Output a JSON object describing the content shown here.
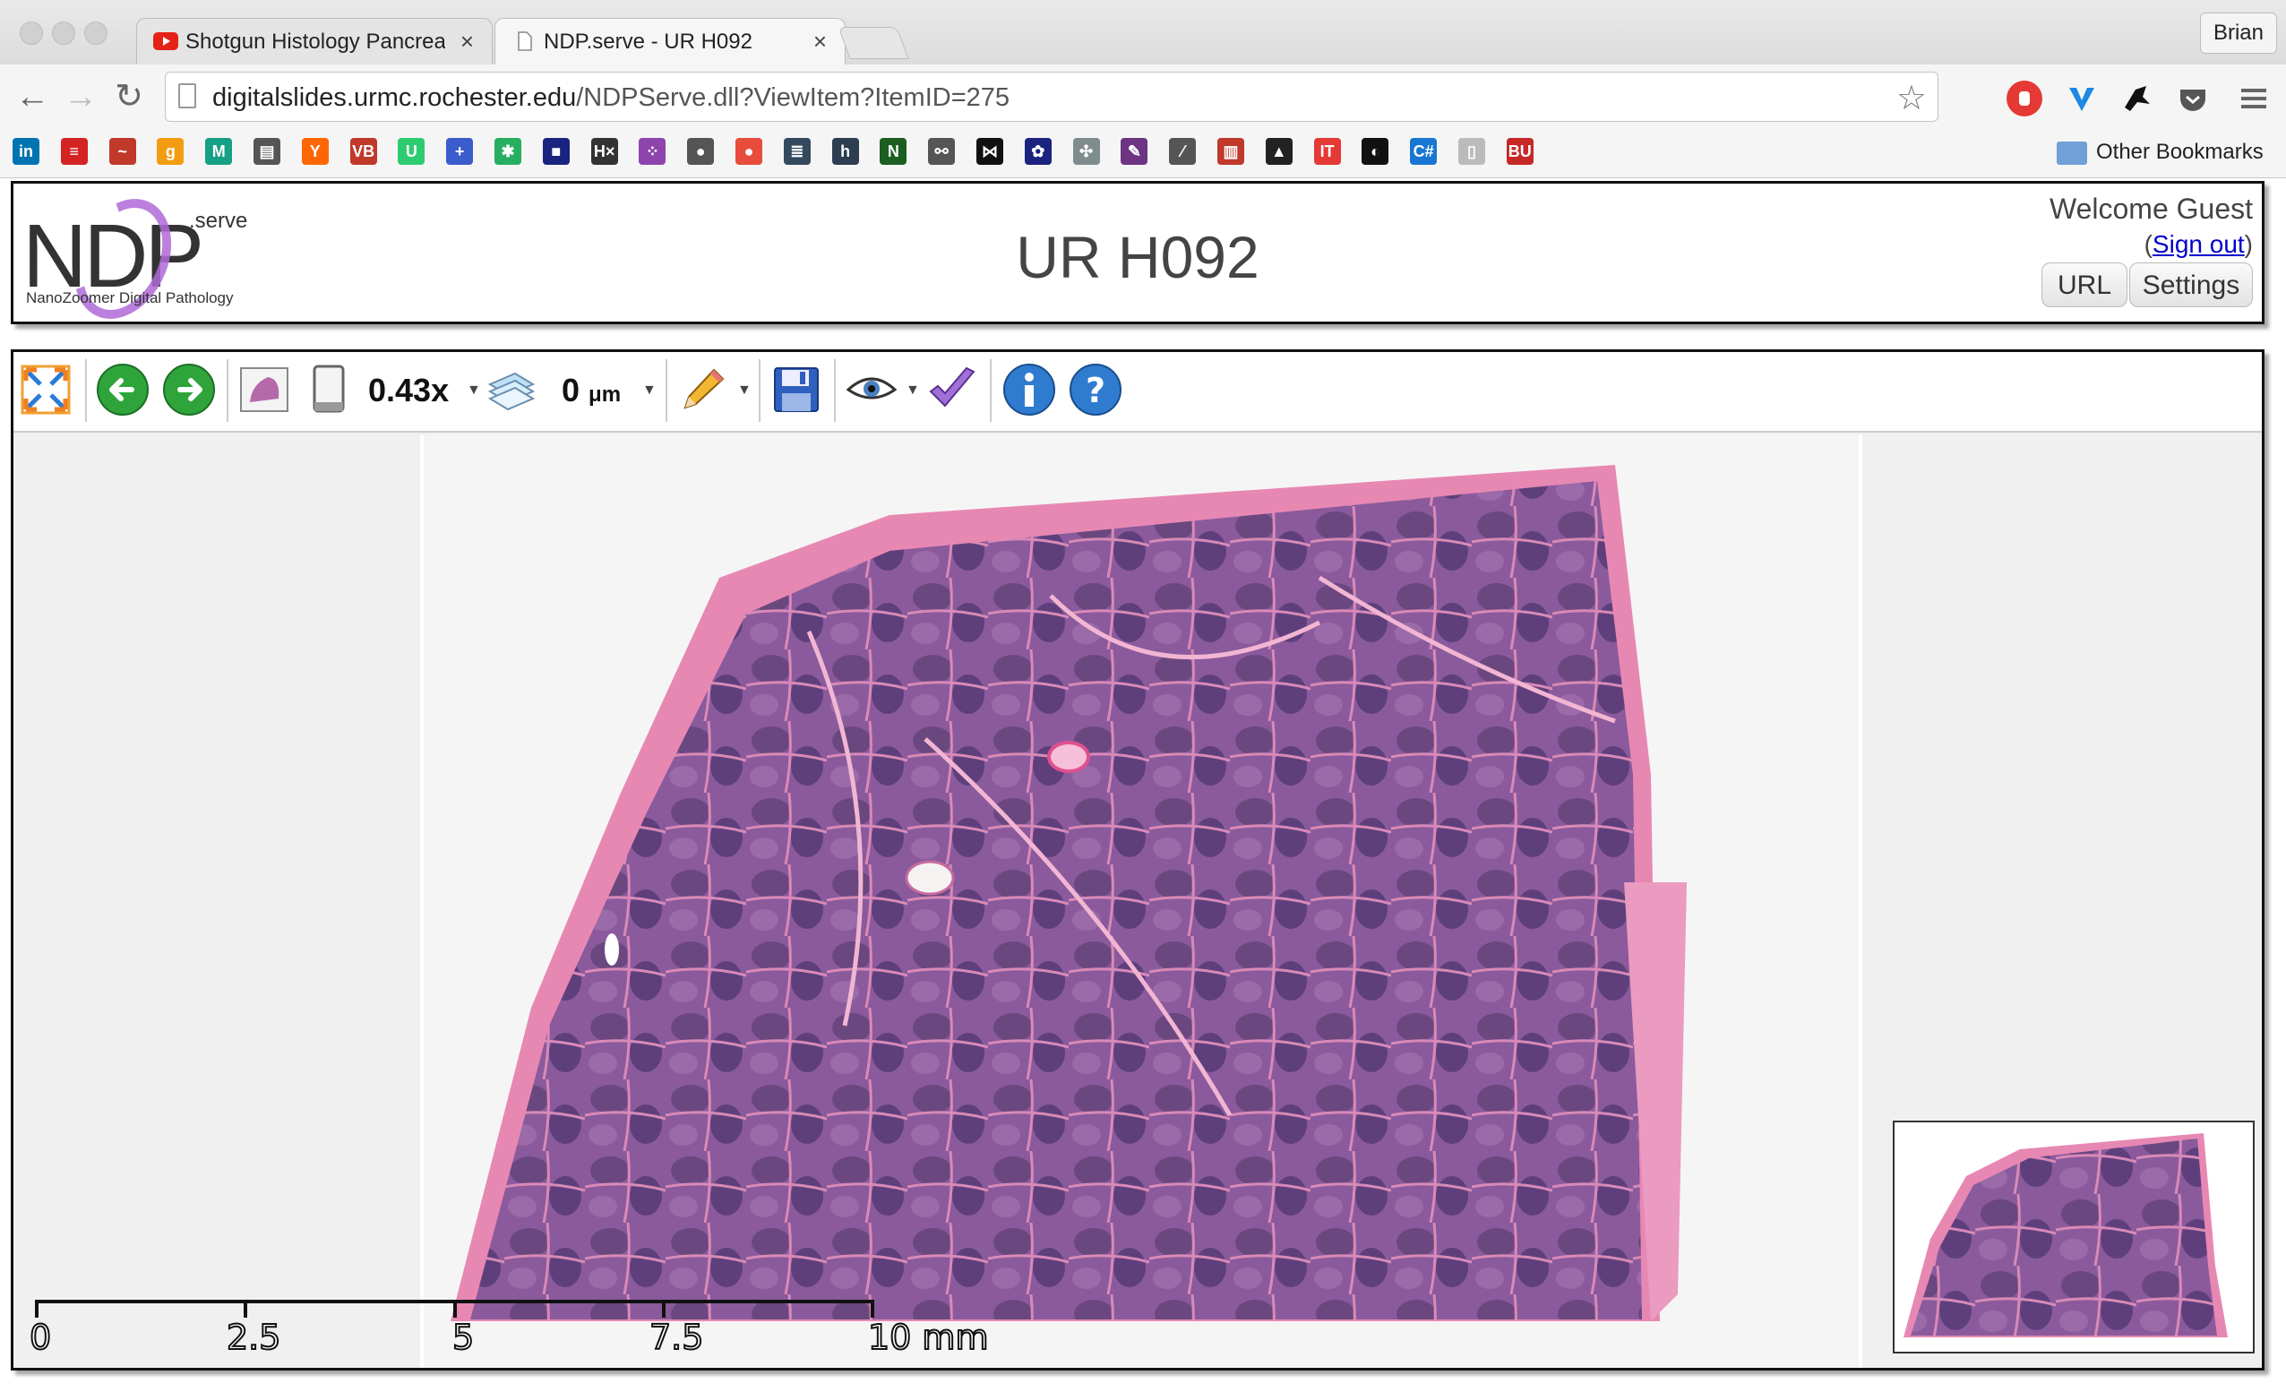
{
  "browser": {
    "tabs": [
      {
        "title": "Shotgun Histology Pancrea",
        "close": "×",
        "favicon": "youtube-icon",
        "color": "#e62117"
      },
      {
        "title": "NDP.serve - UR H092",
        "close": "×",
        "favicon": "page-icon"
      }
    ],
    "profile": "Brian",
    "url_host": "digitalslides.urmc.rochester.edu",
    "url_path": "/NDPServe.dll?ViewItem?ItemID=275",
    "bookmarks": [
      {
        "label": "in",
        "color": "#0073b1"
      },
      {
        "label": "≡",
        "color": "#d32323"
      },
      {
        "label": "~",
        "color": "#c0392b"
      },
      {
        "label": "g",
        "color": "#f39c12"
      },
      {
        "label": "M",
        "color": "#16a085"
      },
      {
        "label": "▤",
        "color": "#555555"
      },
      {
        "label": "Y",
        "color": "#ff6600"
      },
      {
        "label": "VB",
        "color": "#c0392b"
      },
      {
        "label": "U",
        "color": "#2ecc71"
      },
      {
        "label": "+",
        "color": "#3b5ccc"
      },
      {
        "label": "✱",
        "color": "#27ae60"
      },
      {
        "label": "■",
        "color": "#1a237e"
      },
      {
        "label": "H×",
        "color": "#333333"
      },
      {
        "label": "⁘",
        "color": "#8e44ad"
      },
      {
        "label": "●",
        "color": "#555555"
      },
      {
        "label": "●",
        "color": "#e74c3c"
      },
      {
        "label": "≣",
        "color": "#34495e"
      },
      {
        "label": "h",
        "color": "#2c3e50"
      },
      {
        "label": "N",
        "color": "#1b5e20"
      },
      {
        "label": "⚯",
        "color": "#555555"
      },
      {
        "label": "⋈",
        "color": "#111111"
      },
      {
        "label": "✿",
        "color": "#1a237e"
      },
      {
        "label": "✣",
        "color": "#7f8c8d"
      },
      {
        "label": "✎",
        "color": "#6c3483"
      },
      {
        "label": "⁄",
        "color": "#555555"
      },
      {
        "label": "▥",
        "color": "#c0392b"
      },
      {
        "label": "▲",
        "color": "#222222"
      },
      {
        "label": "IT",
        "color": "#e53935"
      },
      {
        "label": "◐",
        "color": "#111111"
      },
      {
        "label": "C#",
        "color": "#1976d2"
      },
      {
        "label": "▯",
        "color": "#bbbbbb"
      },
      {
        "label": "BU",
        "color": "#c62828"
      }
    ],
    "other_bookmarks": "Other Bookmarks"
  },
  "page": {
    "logo": {
      "main": "NDP",
      "superscript": ".serve",
      "subtitle": "NanoZoomer Digital Pathology"
    },
    "title": "UR H092",
    "welcome": "Welcome Guest",
    "sign_out": "Sign out",
    "url_button": "URL",
    "settings_button": "Settings"
  },
  "viewer": {
    "zoom": "0.43x",
    "depth": "0",
    "depth_unit": "μm",
    "scale_labels": [
      "0",
      "2.5",
      "5",
      "7.5",
      "10 mm"
    ],
    "colors": {
      "tissue": "#8a5a9c",
      "tissue_dark": "#5e3f7c",
      "stroma": "#e07aa8",
      "background": "#f5f5f5"
    }
  }
}
